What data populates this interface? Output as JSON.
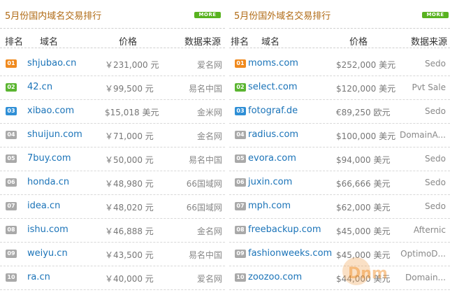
{
  "domestic": {
    "title": "5月份国内域名交易排行",
    "more_label": "MORE",
    "headers": {
      "rank": "排名",
      "domain": "域名",
      "price": "价格",
      "source": "数据来源"
    },
    "rows": [
      {
        "rank": "01",
        "domain": "shjubao.cn",
        "price": "￥231,000 元",
        "source": "爱名网"
      },
      {
        "rank": "02",
        "domain": "42.cn",
        "price": "￥99,500 元",
        "source": "易名中国"
      },
      {
        "rank": "03",
        "domain": "xibao.com",
        "price": "$15,018 美元",
        "source": "金米网"
      },
      {
        "rank": "04",
        "domain": "shuijun.com",
        "price": "￥71,000 元",
        "source": "金名网"
      },
      {
        "rank": "05",
        "domain": "7buy.com",
        "price": "￥50,000 元",
        "source": "易名中国"
      },
      {
        "rank": "06",
        "domain": "honda.cn",
        "price": "￥48,980 元",
        "source": "66国域网"
      },
      {
        "rank": "07",
        "domain": "idea.cn",
        "price": "￥48,020 元",
        "source": "66国域网"
      },
      {
        "rank": "08",
        "domain": "ishu.com",
        "price": "￥46,888 元",
        "source": "金名网"
      },
      {
        "rank": "09",
        "domain": "weiyu.cn",
        "price": "￥43,500 元",
        "source": "易名中国"
      },
      {
        "rank": "10",
        "domain": "ra.cn",
        "price": "￥40,000 元",
        "source": "爱名网"
      }
    ]
  },
  "foreign": {
    "title": "5月份国外域名交易排行",
    "more_label": "MORE",
    "headers": {
      "rank": "排名",
      "domain": "域名",
      "price": "价格",
      "source": "数据来源"
    },
    "rows": [
      {
        "rank": "01",
        "domain": "moms.com",
        "price": "$252,000 美元",
        "source": "Sedo"
      },
      {
        "rank": "02",
        "domain": "select.com",
        "price": "$120,000 美元",
        "source": "Pvt Sale"
      },
      {
        "rank": "03",
        "domain": "fotograf.de",
        "price": "€89,250 欧元",
        "source": "Sedo"
      },
      {
        "rank": "04",
        "domain": "radius.com",
        "price": "$100,000 美元",
        "source": "DomainA..."
      },
      {
        "rank": "05",
        "domain": "evora.com",
        "price": "$94,000 美元",
        "source": "Sedo"
      },
      {
        "rank": "06",
        "domain": "juxin.com",
        "price": "$66,666 美元",
        "source": "Sedo"
      },
      {
        "rank": "07",
        "domain": "mph.com",
        "price": "$62,000 美元",
        "source": "Sedo"
      },
      {
        "rank": "08",
        "domain": "freebackup.com",
        "price": "$45,000 美元",
        "source": "Afternic"
      },
      {
        "rank": "09",
        "domain": "fashionweeks.com",
        "price": "$45,000 美元",
        "source": "OptimoD..."
      },
      {
        "rank": "10",
        "domain": "zoozoo.com",
        "price": "$44,000 美元",
        "source": "Domain..."
      }
    ]
  },
  "badge_colors": {
    "first": "#f08a1e",
    "second": "#5bb531",
    "third": "#2f8fd6",
    "other": "#a9a9a9"
  },
  "watermark_text": "Dnm"
}
